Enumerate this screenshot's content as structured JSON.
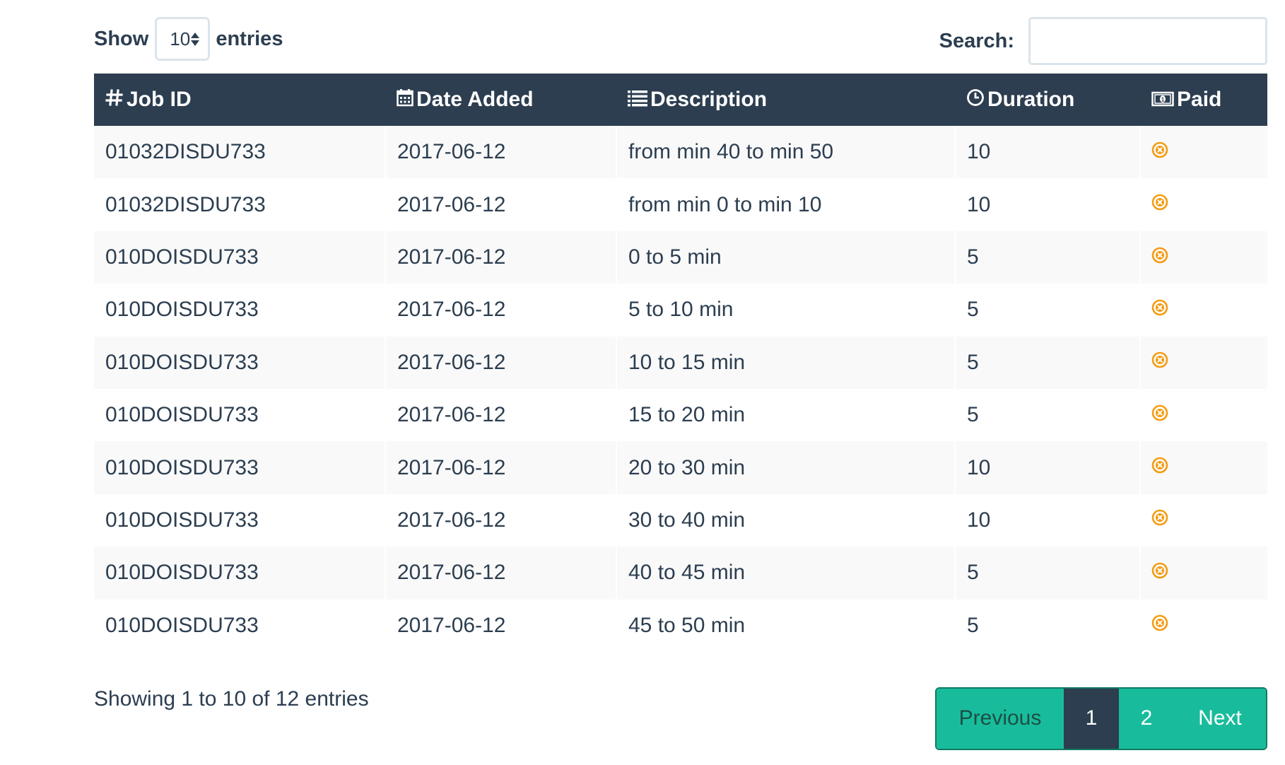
{
  "length_control": {
    "prefix": "Show",
    "selected": "10",
    "suffix": "entries"
  },
  "search": {
    "label": "Search:",
    "value": "",
    "placeholder": ""
  },
  "table": {
    "headers": [
      {
        "label": "Job ID",
        "icon": "hash-icon"
      },
      {
        "label": "Date Added",
        "icon": "calendar-icon"
      },
      {
        "label": "Description",
        "icon": "list-icon"
      },
      {
        "label": "Duration",
        "icon": "clock-icon"
      },
      {
        "label": "Paid",
        "icon": "money-icon"
      }
    ],
    "rows": [
      {
        "job_id": "01032DISDU733",
        "date": "2017-06-12",
        "description": "from min 40 to min 50",
        "duration": "10",
        "paid_icon": "times-circle-icon"
      },
      {
        "job_id": "01032DISDU733",
        "date": "2017-06-12",
        "description": "from min 0 to min 10",
        "duration": "10",
        "paid_icon": "times-circle-icon"
      },
      {
        "job_id": "010DOISDU733",
        "date": "2017-06-12",
        "description": "0 to 5 min",
        "duration": "5",
        "paid_icon": "times-circle-icon"
      },
      {
        "job_id": "010DOISDU733",
        "date": "2017-06-12",
        "description": "5 to 10 min",
        "duration": "5",
        "paid_icon": "times-circle-icon"
      },
      {
        "job_id": "010DOISDU733",
        "date": "2017-06-12",
        "description": "10 to 15 min",
        "duration": "5",
        "paid_icon": "times-circle-icon"
      },
      {
        "job_id": "010DOISDU733",
        "date": "2017-06-12",
        "description": "15 to 20 min",
        "duration": "5",
        "paid_icon": "times-circle-icon"
      },
      {
        "job_id": "010DOISDU733",
        "date": "2017-06-12",
        "description": "20 to 30 min",
        "duration": "10",
        "paid_icon": "times-circle-icon"
      },
      {
        "job_id": "010DOISDU733",
        "date": "2017-06-12",
        "description": "30 to 40 min",
        "duration": "10",
        "paid_icon": "times-circle-icon"
      },
      {
        "job_id": "010DOISDU733",
        "date": "2017-06-12",
        "description": "40 to 45 min",
        "duration": "5",
        "paid_icon": "times-circle-icon"
      },
      {
        "job_id": "010DOISDU733",
        "date": "2017-06-12",
        "description": "45 to 50 min",
        "duration": "5",
        "paid_icon": "times-circle-icon"
      }
    ]
  },
  "footer": {
    "info": "Showing 1 to 10 of 12 entries"
  },
  "pagination": {
    "previous": "Previous",
    "pages": [
      "1",
      "2"
    ],
    "active_page": "1",
    "next": "Next"
  },
  "colors": {
    "header_bg": "#2c3e50",
    "accent": "#18bc9c",
    "unpaid_icon": "#f39c12",
    "text": "#2c3e50"
  }
}
